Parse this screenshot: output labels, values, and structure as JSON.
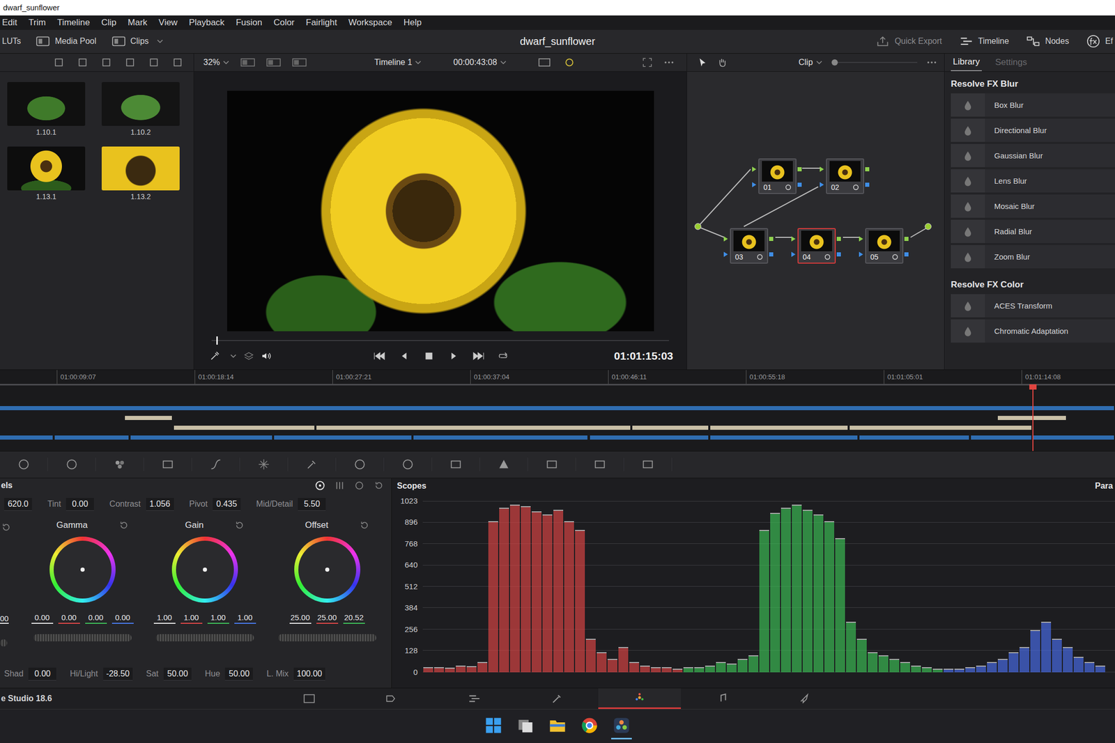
{
  "window": {
    "title": "dwarf_sunflower"
  },
  "menu": [
    "Edit",
    "Trim",
    "Timeline",
    "Clip",
    "Mark",
    "View",
    "Playback",
    "Fusion",
    "Color",
    "Fairlight",
    "Workspace",
    "Help"
  ],
  "toolbar": {
    "left": [
      "LUTs",
      "Media Pool",
      "Clips"
    ],
    "project": "dwarf_sunflower",
    "right": [
      {
        "label": "Quick Export",
        "disabled": true
      },
      {
        "label": "Timeline",
        "disabled": false
      },
      {
        "label": "Nodes",
        "disabled": false
      },
      {
        "label": "Ef",
        "disabled": false
      }
    ]
  },
  "gallery": {
    "stills": [
      {
        "label": "1.10.1"
      },
      {
        "label": "1.10.2"
      },
      {
        "label": "1.13.1"
      },
      {
        "label": "1.13.2"
      }
    ]
  },
  "viewer": {
    "zoom": "32%",
    "timeline": "Timeline 1",
    "duration": "00:00:43:08",
    "timecode": "01:01:15:03",
    "scrub_level": 0.01
  },
  "nodes": {
    "mode": "Clip",
    "items": [
      {
        "label": "01",
        "selected": false
      },
      {
        "label": "02",
        "selected": false
      },
      {
        "label": "03",
        "selected": false
      },
      {
        "label": "04",
        "selected": true
      },
      {
        "label": "05",
        "selected": false
      }
    ]
  },
  "library": {
    "tabs": [
      {
        "label": "Library",
        "selected": true
      },
      {
        "label": "Settings",
        "selected": false
      }
    ],
    "sections": [
      {
        "title": "Resolve FX Blur",
        "items": [
          "Box Blur",
          "Directional Blur",
          "Gaussian Blur",
          "Lens Blur",
          "Mosaic Blur",
          "Radial Blur",
          "Zoom Blur"
        ]
      },
      {
        "title": "Resolve FX Color",
        "items": [
          "ACES Transform",
          "Chromatic Adaptation"
        ]
      }
    ]
  },
  "timeline": {
    "ruler": [
      "01:00:09:07",
      "01:00:18:14",
      "01:00:27:21",
      "01:00:37:04",
      "01:00:46:11",
      "01:00:55:18",
      "01:01:05:01",
      "01:01:14:08"
    ],
    "playhead_level": 0.926,
    "tracks": [
      {
        "color": "#2f6db0",
        "clips": [
          [
            0,
            1
          ]
        ]
      },
      {
        "color": "#c9bfa6",
        "clips": [
          [
            0.112,
            0.155
          ],
          [
            0.895,
            0.957
          ]
        ]
      },
      {
        "color": "#c9bfa6",
        "clips": [
          [
            0.156,
            0.283
          ],
          [
            0.284,
            0.566
          ],
          [
            0.567,
            0.636
          ],
          [
            0.637,
            0.761
          ],
          [
            0.762,
            0.926
          ]
        ]
      },
      {
        "color": "#2f6db0",
        "clips": [
          [
            0,
            0.048
          ],
          [
            0.049,
            0.116
          ],
          [
            0.117,
            0.245
          ],
          [
            0.246,
            0.37
          ],
          [
            0.371,
            0.528
          ],
          [
            0.529,
            0.636
          ],
          [
            0.637,
            0.77
          ],
          [
            0.771,
            0.87
          ],
          [
            0.871,
            0.926
          ],
          [
            0.927,
            1
          ]
        ]
      }
    ]
  },
  "color_panel": {
    "title": "els",
    "temp": "620.0",
    "params": [
      {
        "label": "Tint",
        "value": "0.00"
      },
      {
        "label": "Contrast",
        "value": "1.056"
      },
      {
        "label": "Pivot",
        "value": "0.435"
      },
      {
        "label": "Mid/Detail",
        "value": "5.50"
      }
    ],
    "lift_values": "00",
    "wheels": [
      {
        "name": "Gamma",
        "values": [
          "0.00",
          "0.00",
          "0.00",
          "0.00"
        ]
      },
      {
        "name": "Gain",
        "values": [
          "1.00",
          "1.00",
          "1.00",
          "1.00"
        ]
      },
      {
        "name": "Offset",
        "values": [
          "25.00",
          "25.00",
          "20.52"
        ]
      }
    ],
    "bottom": [
      {
        "label": "Shad",
        "value": "0.00"
      },
      {
        "label": "Hi/Light",
        "value": "-28.50"
      },
      {
        "label": "Sat",
        "value": "50.00"
      },
      {
        "label": "Hue",
        "value": "50.00"
      },
      {
        "label": "L. Mix",
        "value": "100.00"
      }
    ]
  },
  "scopes": {
    "title": "Scopes",
    "mode": "Para",
    "axis": [
      "1023",
      "896",
      "768",
      "640",
      "512",
      "384",
      "256",
      "128",
      "0"
    ],
    "series": [
      {
        "color": "#e04545",
        "values": [
          30,
          30,
          25,
          40,
          35,
          60,
          900,
          980,
          1000,
          990,
          960,
          940,
          970,
          900,
          850,
          200,
          120,
          80,
          150,
          60,
          40,
          30,
          30,
          20
        ]
      },
      {
        "color": "#3cc457",
        "values": [
          30,
          30,
          40,
          60,
          50,
          80,
          100,
          850,
          950,
          980,
          1000,
          970,
          940,
          900,
          800,
          300,
          200,
          120,
          100,
          80,
          60,
          40,
          30,
          20
        ]
      },
      {
        "color": "#4a6ff0",
        "values": [
          20,
          20,
          30,
          40,
          60,
          80,
          120,
          150,
          250,
          300,
          200,
          150,
          90,
          60,
          40
        ]
      }
    ]
  },
  "status": {
    "app": "e Studio 18.6",
    "pages": [
      {
        "selected": false
      },
      {
        "selected": false
      },
      {
        "selected": false
      },
      {
        "selected": false
      },
      {
        "selected": true
      },
      {
        "selected": false
      },
      {
        "selected": false
      }
    ]
  },
  "taskbar": [
    {
      "active": false
    },
    {
      "active": false
    },
    {
      "active": false
    },
    {
      "active": false
    },
    {
      "active": true
    }
  ]
}
